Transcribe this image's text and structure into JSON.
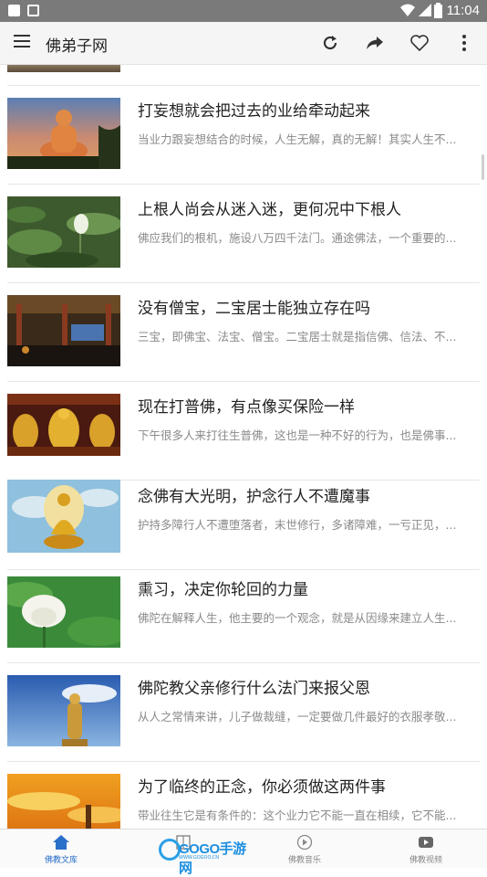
{
  "status_bar": {
    "time": "11:04"
  },
  "app_bar": {
    "title": "佛弟子网",
    "actions": [
      "refresh-icon",
      "share-icon",
      "heart-icon",
      "more-vert-icon"
    ]
  },
  "articles": [
    {
      "title": "打妄想就会把过去的业给牵动起来",
      "summary": "当业力跟妄想结合的时候，人生无解，真的无解！其实人生不...",
      "thumb": "buddha-statue-sunset"
    },
    {
      "title": "上根人尚会从迷入迷，更何况中下根人",
      "summary": "佛应我们的根机，施设八万四千法门。通途佛法，一个重要的...",
      "thumb": "lotus-pond"
    },
    {
      "title": "没有僧宝，二宝居士能独立存在吗",
      "summary": "三宝，即佛宝、法宝、僧宝。二宝居士就是指信佛、信法、不...",
      "thumb": "temple-hall-interior"
    },
    {
      "title": "现在打普佛，有点像买保险一样",
      "summary": "下午很多人来打往生普佛，这也是一种不好的行为，也是佛事...",
      "thumb": "golden-buddha-altar"
    },
    {
      "title": "念佛有大光明，护念行人不遭魔事",
      "summary": "护持多障行人不遭堕落者，末世修行，多诸障难，一亏正见，...",
      "thumb": "golden-buddha-sky"
    },
    {
      "title": "熏习，决定你轮回的力量",
      "summary": "佛陀在解释人生，他主要的一个观念，就是从因缘来建立人生...",
      "thumb": "white-lotus"
    },
    {
      "title": "佛陀教父亲修行什么法门来报父恩",
      "summary": "从人之常情来讲，儿子做裁缝，一定要做几件最好的衣服孝敬...",
      "thumb": "standing-buddha-statue"
    },
    {
      "title": "为了临终的正念，你必须做这两件事",
      "summary": "带业往生它是有条件的：这个业力它不能一直在相续，它不能...",
      "thumb": "sunset-clouds-pagoda"
    }
  ],
  "tabs": [
    {
      "label": "佛教文库",
      "icon": "home-icon",
      "active": true
    },
    {
      "label": "",
      "icon": "book-icon",
      "active": false
    },
    {
      "label": "佛教音乐",
      "icon": "music-icon",
      "active": false
    },
    {
      "label": "佛教视频",
      "icon": "video-icon",
      "active": false
    }
  ],
  "watermark": {
    "text": "GOGO手游网",
    "subtext": "WWW.GOGOO.CN"
  },
  "colors": {
    "accent": "#2a6fc9",
    "appbar_bg": "#f5f5f5",
    "status_bg": "#7a7a7a"
  }
}
